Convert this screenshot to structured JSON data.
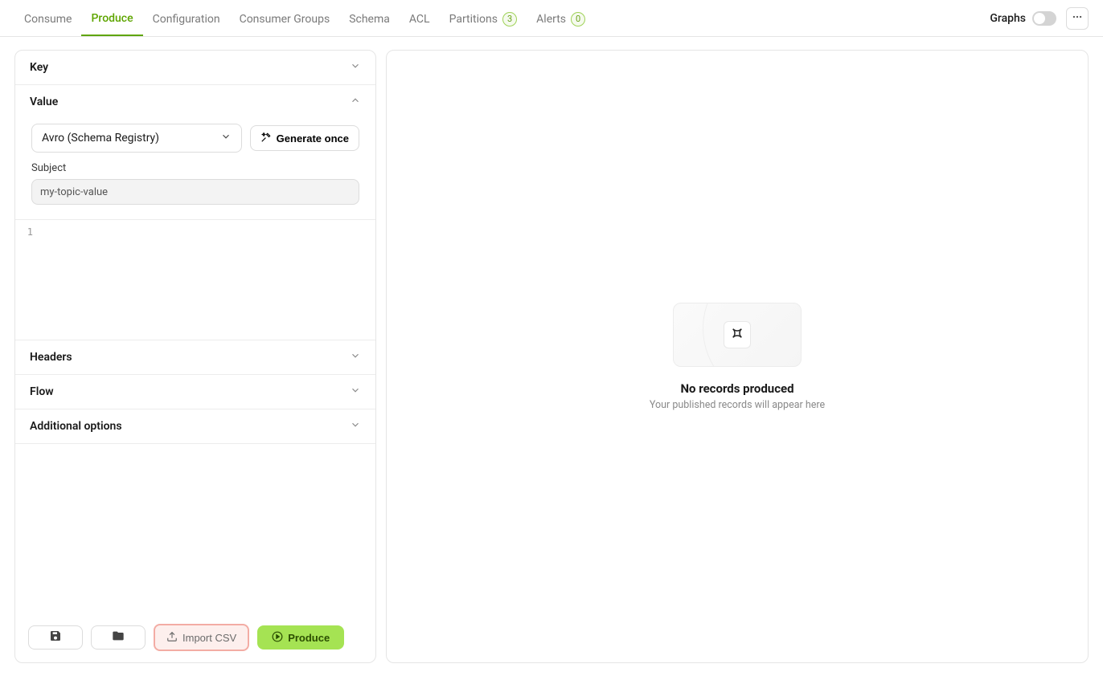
{
  "tabs": {
    "consume": "Consume",
    "produce": "Produce",
    "configuration": "Configuration",
    "consumer_groups": "Consumer Groups",
    "schema": "Schema",
    "acl": "ACL",
    "partitions": "Partitions",
    "partitions_count": "3",
    "alerts": "Alerts",
    "alerts_count": "0"
  },
  "toolbar": {
    "graphs_label": "Graphs"
  },
  "sections": {
    "key": "Key",
    "value": "Value",
    "headers": "Headers",
    "flow": "Flow",
    "additional_options": "Additional options"
  },
  "value_panel": {
    "format_selected": "Avro (Schema Registry)",
    "generate_once": "Generate once",
    "subject_label": "Subject",
    "subject_value": "my-topic-value",
    "editor_line_1": "1"
  },
  "bottom": {
    "import_csv": "Import CSV",
    "produce": "Produce"
  },
  "empty": {
    "title": "No records produced",
    "subtitle": "Your published records will appear here"
  }
}
